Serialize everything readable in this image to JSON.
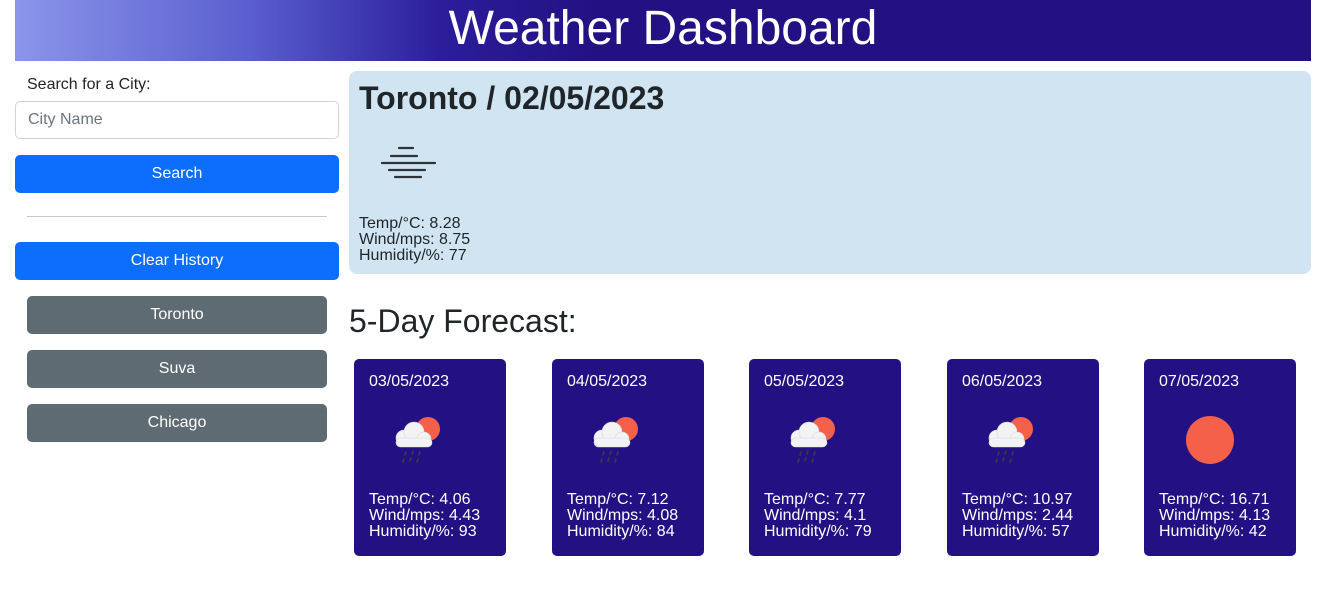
{
  "header": {
    "title": "Weather Dashboard"
  },
  "sidebar": {
    "search_label": "Search for a City:",
    "city_input": {
      "value": "",
      "placeholder": "City Name"
    },
    "search_button": "Search",
    "clear_button": "Clear History",
    "history": [
      "Toronto",
      "Suva",
      "Chicago"
    ]
  },
  "current": {
    "title": "Toronto / 02/05/2023",
    "icon": "fog-icon",
    "temp": "Temp/°C: 8.28",
    "wind": "Wind/mps: 8.75",
    "humidity": "Humidity/%: 77"
  },
  "forecast": {
    "title": "5-Day Forecast:",
    "days": [
      {
        "date": "03/05/2023",
        "icon": "rain-cloud-sun-icon",
        "temp": "Temp/°C: 4.06",
        "wind": "Wind/mps: 4.43",
        "humidity": "Humidity/%: 93"
      },
      {
        "date": "04/05/2023",
        "icon": "rain-cloud-sun-icon",
        "temp": "Temp/°C: 7.12",
        "wind": "Wind/mps: 4.08",
        "humidity": "Humidity/%: 84"
      },
      {
        "date": "05/05/2023",
        "icon": "rain-cloud-sun-icon",
        "temp": "Temp/°C: 7.77",
        "wind": "Wind/mps: 4.1",
        "humidity": "Humidity/%: 79"
      },
      {
        "date": "06/05/2023",
        "icon": "rain-cloud-sun-icon",
        "temp": "Temp/°C: 10.97",
        "wind": "Wind/mps: 2.44",
        "humidity": "Humidity/%: 57"
      },
      {
        "date": "07/05/2023",
        "icon": "sun-icon",
        "temp": "Temp/°C: 16.71",
        "wind": "Wind/mps: 4.13",
        "humidity": "Humidity/%: 42"
      }
    ]
  },
  "colors": {
    "header_dark": "#231183",
    "primary_button": "#0d6efd",
    "history_button": "#5f6b73",
    "current_panel": "#d0e4f2",
    "forecast_card": "#231183",
    "sun": "#f4604a"
  }
}
